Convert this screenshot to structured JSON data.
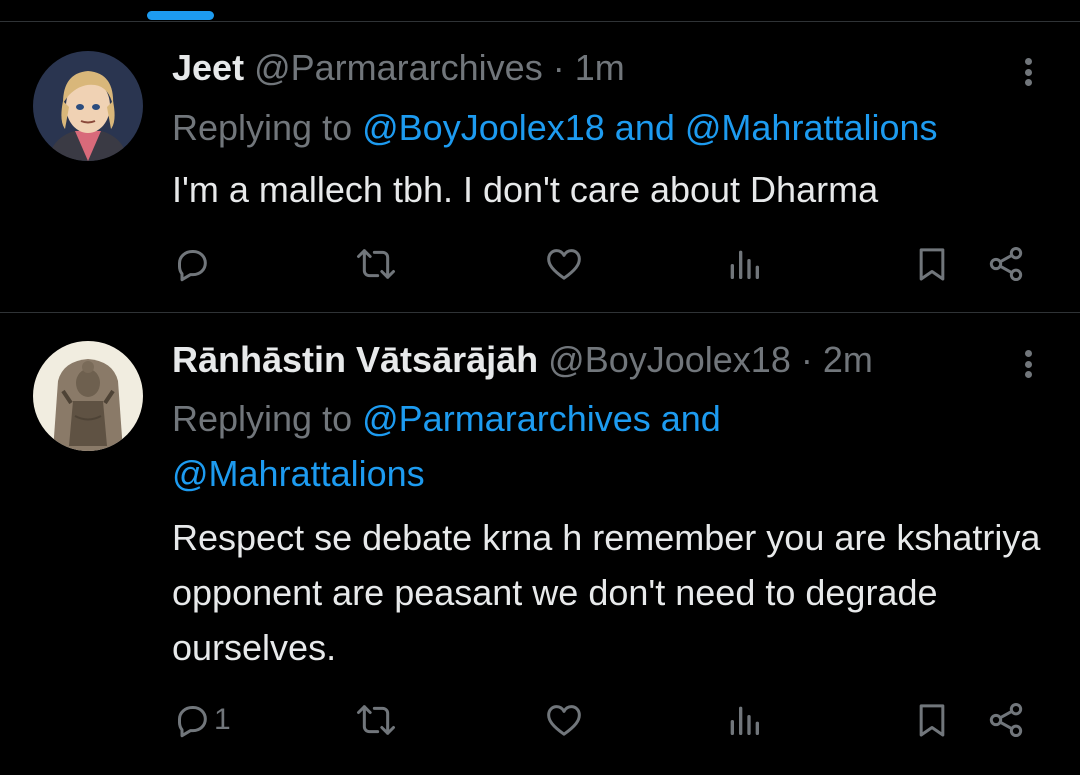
{
  "colors": {
    "background": "#000000",
    "accent": "#1d9bf0",
    "text": "#e7e9ea",
    "muted": "#71767b",
    "divider": "#2f3336"
  },
  "tweets": [
    {
      "name": "Jeet",
      "handle": "@Parmararchives",
      "separator": "·",
      "time": "1m",
      "replying_prefix": "Replying to",
      "mentions": "@BoyJoolex18 and @Mahrattalions",
      "text": "I'm a mallech tbh. I don't care about Dharma",
      "reply_count": ""
    },
    {
      "name": "Rānhāstin Vātsārājāh",
      "handle": "@BoyJoolex18",
      "separator": "·",
      "time": "2m",
      "replying_prefix": "Replying to",
      "mentions": "@Parmararchives and @Mahrattalions",
      "text": "Respect se debate krna h remember you are kshatriya opponent are peasant we don't need to degrade ourselves.",
      "reply_count": "1"
    }
  ],
  "icons": [
    "reply-icon",
    "retweet-icon",
    "like-icon",
    "views-icon",
    "bookmark-icon",
    "share-icon",
    "more-icon"
  ]
}
